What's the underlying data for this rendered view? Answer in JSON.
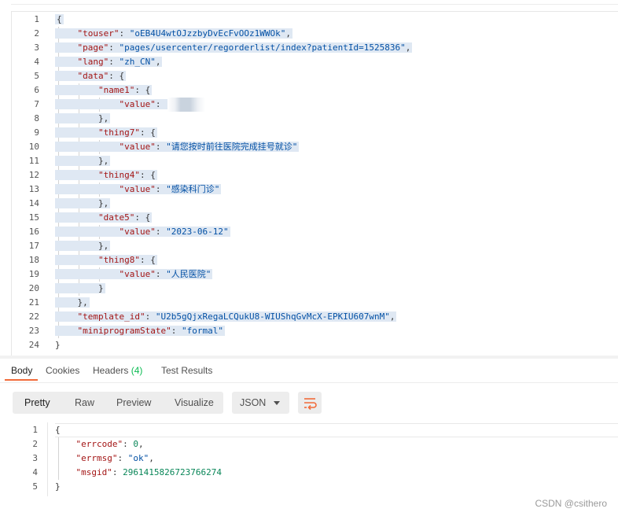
{
  "request_body": {
    "line_numbers": [
      "1",
      "2",
      "3",
      "4",
      "5",
      "6",
      "7",
      "8",
      "9",
      "10",
      "11",
      "12",
      "13",
      "14",
      "15",
      "16",
      "17",
      "18",
      "19",
      "20",
      "21",
      "22",
      "23",
      "24"
    ],
    "touser_key": "\"touser\"",
    "touser_value": "\"oEB4U4wtOJzzbyDvEcFvOOz1WWOk\"",
    "page_key": "\"page\"",
    "page_value": "\"pages/usercenter/regorderlist/index?patientId=1525836\"",
    "lang_key": "\"lang\"",
    "lang_value": "\"zh_CN\"",
    "data_key": "\"data\"",
    "name1_key": "\"name1\"",
    "thing7_key": "\"thing7\"",
    "thing7_value": "\"请您按时前往医院完成挂号就诊\"",
    "thing4_key": "\"thing4\"",
    "thing4_value": "\"感染科门诊\"",
    "date5_key": "\"date5\"",
    "date5_value": "\"2023-06-12\"",
    "thing8_key": "\"thing8\"",
    "thing8_value": "\"人民医院\"",
    "value_key": "\"value\"",
    "template_id_key": "\"template_id\"",
    "template_id_value": "\"U2b5gQjxRegaLCQukU8-WIUShqGvMcX-EPKIU607wnM\"",
    "miniprogram_state_key": "\"miniprogramState\"",
    "miniprogram_state_value": "\"formal\""
  },
  "response_tabs": {
    "body": "Body",
    "cookies": "Cookies",
    "headers": "Headers",
    "headers_count": "(4)",
    "test_results": "Test Results"
  },
  "toolbar": {
    "pretty": "Pretty",
    "raw": "Raw",
    "preview": "Preview",
    "visualize": "Visualize",
    "format": "JSON",
    "wrap_icon": "wrap-lines-icon"
  },
  "response_body": {
    "line_numbers": [
      "1",
      "2",
      "3",
      "4",
      "5"
    ],
    "errcode_key": "\"errcode\"",
    "errcode_value": "0",
    "errmsg_key": "\"errmsg\"",
    "errmsg_value": "\"ok\"",
    "msgid_key": "\"msgid\"",
    "msgid_value": "2961415826723766274"
  },
  "watermark": "CSDN @csithero",
  "colors": {
    "accent": "#f26b3a",
    "json_key": "#a31515",
    "json_string": "#0451a5",
    "json_number": "#098658",
    "selection": "#dfe8f3",
    "count_green": "#0cbb52"
  }
}
